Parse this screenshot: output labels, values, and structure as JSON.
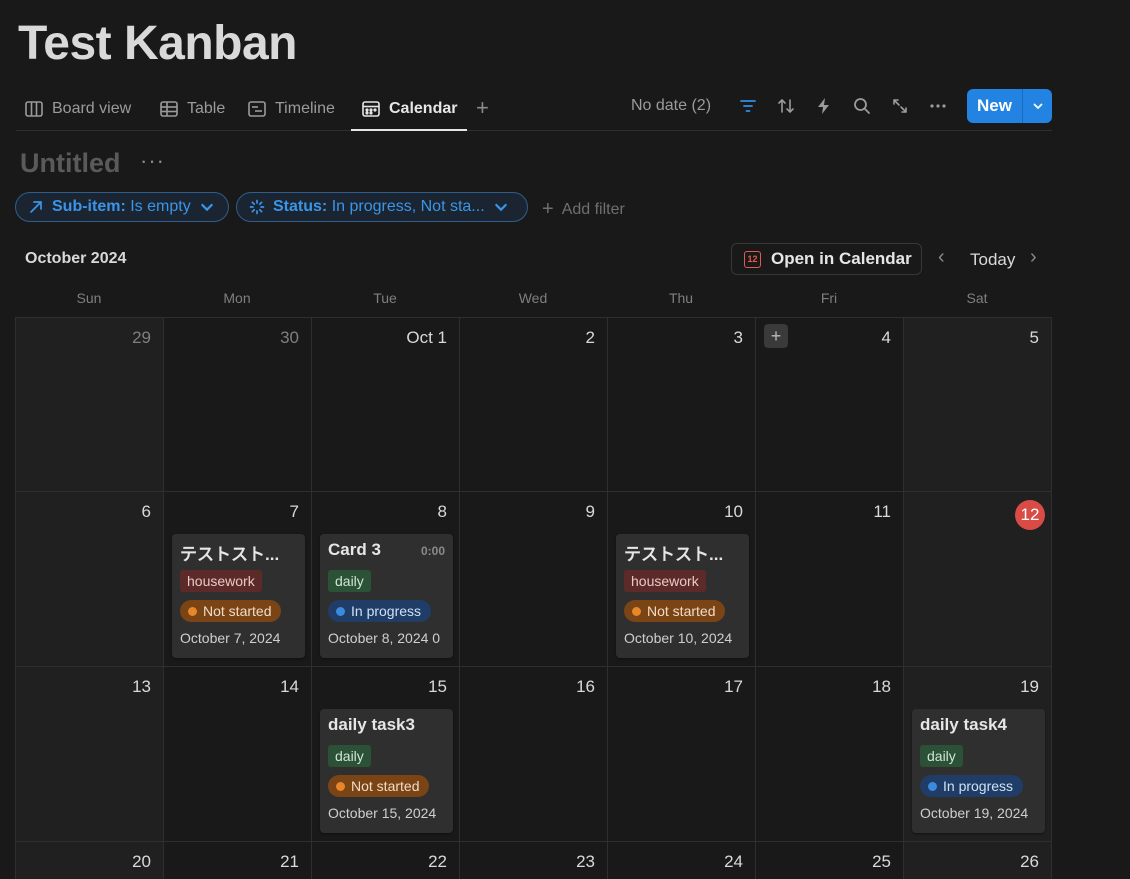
{
  "page": {
    "title": "Test Kanban"
  },
  "tabs": [
    {
      "label": "Board view",
      "icon": "board-icon"
    },
    {
      "label": "Table",
      "icon": "table-icon"
    },
    {
      "label": "Timeline",
      "icon": "timeline-icon"
    },
    {
      "label": "Calendar",
      "icon": "calendar-icon",
      "active": true
    }
  ],
  "toolbar": {
    "no_date": "No date (2)",
    "new_label": "New"
  },
  "view": {
    "title": "Untitled",
    "more": "···"
  },
  "filters": {
    "subitem": {
      "key": "Sub-item:",
      "value": "Is empty"
    },
    "status": {
      "key": "Status:",
      "value": "In progress, Not sta..."
    },
    "add": "Add filter"
  },
  "calendar": {
    "month": "October 2024",
    "open_in_calendar": "Open in Calendar",
    "cal_icon_day": "12",
    "today": "Today",
    "weekdays": [
      "Sun",
      "Mon",
      "Tue",
      "Wed",
      "Thu",
      "Fri",
      "Sat"
    ],
    "weeks": [
      [
        "29",
        "30",
        "Oct 1",
        "2",
        "3",
        "4",
        "5"
      ],
      [
        "6",
        "7",
        "8",
        "9",
        "10",
        "11",
        "12"
      ],
      [
        "13",
        "14",
        "15",
        "16",
        "17",
        "18",
        "19"
      ],
      [
        "20",
        "21",
        "22",
        "23",
        "24",
        "25",
        "26"
      ]
    ],
    "today_date": "12"
  },
  "cards": {
    "c1": {
      "title": "テストスト...",
      "tag": "housework",
      "status": "Not started",
      "date": "October 7, 2024"
    },
    "c2": {
      "title": "Card 3",
      "time": "0:00",
      "tag": "daily",
      "status": "In progress",
      "date": "October 8, 2024 0"
    },
    "c3": {
      "title": "テストスト...",
      "tag": "housework",
      "status": "Not started",
      "date": "October 10, 2024"
    },
    "c4": {
      "title": "daily task3",
      "tag": "daily",
      "status": "Not started",
      "date": "October 15, 2024"
    },
    "c5": {
      "title": "daily task4",
      "tag": "daily",
      "status": "In progress",
      "date": "October 19, 2024"
    }
  }
}
